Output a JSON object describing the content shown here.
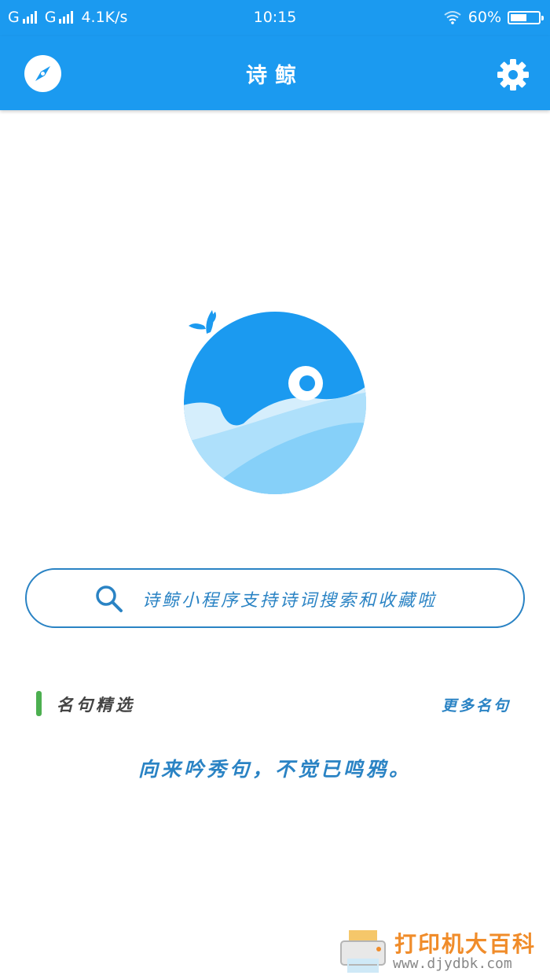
{
  "status_bar": {
    "carrier1": "G",
    "carrier2": "G",
    "speed": "4.1K/s",
    "time": "10:15",
    "battery": "60%",
    "battery_level": 0.6
  },
  "app_bar": {
    "title": "诗鲸",
    "left_icon": "compass-icon",
    "right_icon": "gear-icon"
  },
  "search": {
    "icon": "search-icon",
    "placeholder": "诗鲸小程序支持诗词搜索和收藏啦"
  },
  "section": {
    "title": "名句精选",
    "more_label": "更多名句"
  },
  "quote": "向来吟秀句，不觉已鸣鸦。",
  "watermark": {
    "line1": "打印机大百科",
    "line2": "www.djydbk.com"
  },
  "colors": {
    "primary": "#1b9af0",
    "accent_text": "#2a83c4",
    "section_marker": "#4caf50"
  }
}
